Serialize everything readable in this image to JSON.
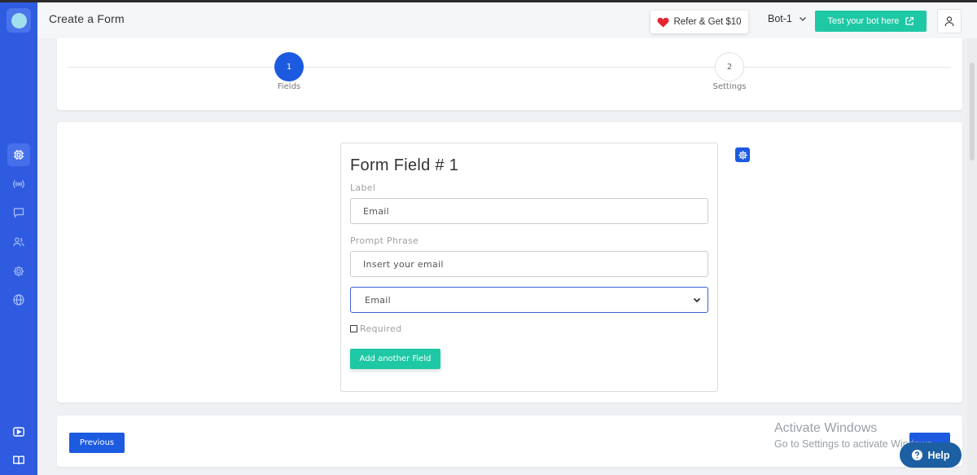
{
  "header": {
    "title": "Create a Form",
    "refer_label": "Refer & Get $10",
    "bot_name": "Bot-1",
    "test_label": "Test your bot here"
  },
  "sidebar": {
    "items": [
      {
        "name": "bot-builder-icon",
        "active": true
      },
      {
        "name": "broadcast-icon",
        "active": false
      },
      {
        "name": "chat-icon",
        "active": false
      },
      {
        "name": "users-icon",
        "active": false
      },
      {
        "name": "settings-icon",
        "active": false
      },
      {
        "name": "globe-icon",
        "active": false
      },
      {
        "name": "video-icon",
        "active": false
      },
      {
        "name": "book-icon",
        "active": false
      }
    ]
  },
  "stepper": {
    "steps": [
      {
        "number": "1",
        "label": "Fields",
        "active": true
      },
      {
        "number": "2",
        "label": "Settings",
        "active": false
      }
    ]
  },
  "form": {
    "title": "Form Field # 1",
    "label_caption": "Label",
    "label_value": "Email",
    "prompt_caption": "Prompt Phrase",
    "prompt_value": "Insert your email",
    "type_selected": "Email",
    "required_label": "Required",
    "required_checked": false,
    "add_field_label": "Add another Field"
  },
  "navigation": {
    "previous_label": "Previous"
  },
  "watermark": {
    "title": "Activate Windows",
    "subtitle": "Go to Settings to activate Windows."
  },
  "help": {
    "label": "Help"
  },
  "colors": {
    "sidebar": "#2f5be0",
    "primary": "#1c5ae0",
    "accent": "#1ec8a5",
    "heart": "#e3262f"
  }
}
